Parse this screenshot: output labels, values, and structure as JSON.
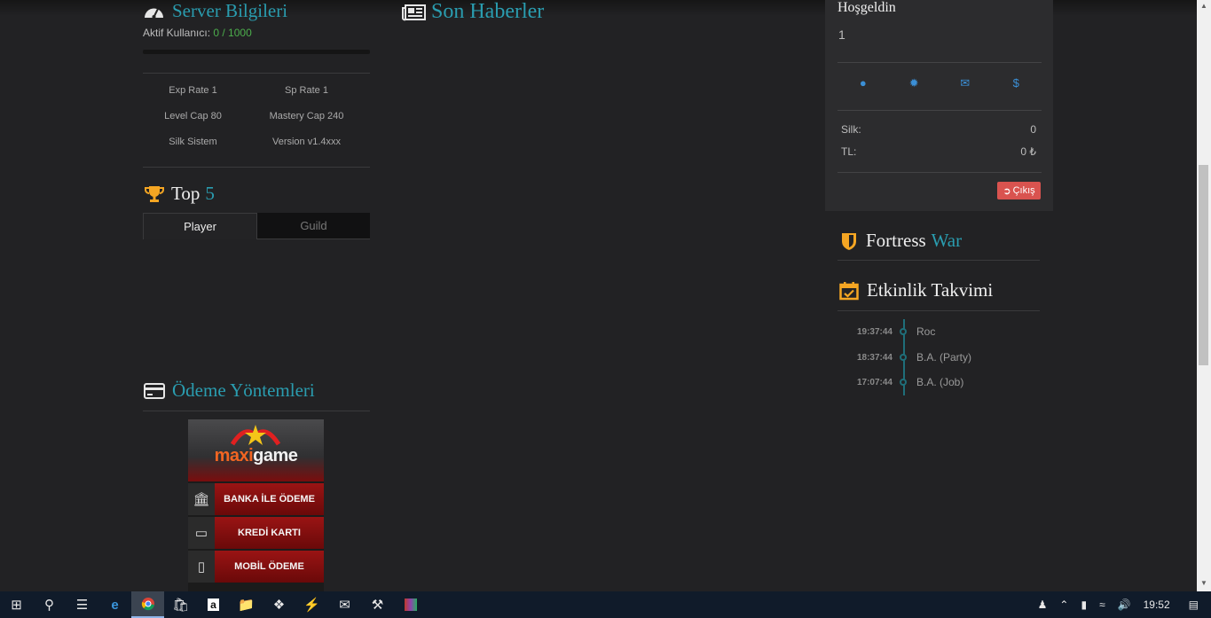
{
  "server": {
    "title": "Server Bilgileri",
    "active_label": "Aktif Kullanıcı:",
    "active_value": "0 / 1000",
    "active_ratio": 0,
    "stats": [
      [
        "Exp Rate 1",
        "Sp Rate 1"
      ],
      [
        "Level Cap 80",
        "Mastery Cap 240"
      ],
      [
        "Silk Sistem",
        "Version v1.4xxx"
      ]
    ]
  },
  "top": {
    "word": "Top",
    "number": "5",
    "tabs": [
      "Player",
      "Guild"
    ]
  },
  "payment": {
    "title": "Ödeme Yöntemleri",
    "brand_left": "maxi",
    "brand_right": "game",
    "methods": [
      "BANKA İLE ÖDEME",
      "KREDİ KARTI",
      "MOBİL ÖDEME"
    ]
  },
  "news": {
    "title": "Son Haberler"
  },
  "user": {
    "greeting": "Hoşgeldin",
    "value": "1",
    "silk_label": "Silk:",
    "silk_value": "0",
    "tl_label": "TL:",
    "tl_value": "0 ₺",
    "logout": "Çıkış"
  },
  "fortress": {
    "word1": "Fortress",
    "word2": "War"
  },
  "events": {
    "title": "Etkinlik Takvimi",
    "items": [
      {
        "time": "19:37:44",
        "name": "Roc"
      },
      {
        "time": "18:37:44",
        "name": "B.A. (Party)"
      },
      {
        "time": "17:07:44",
        "name": "B.A. (Job)"
      }
    ]
  },
  "taskbar": {
    "clock": "19:52"
  },
  "colors": {
    "accent": "#2a9db0",
    "online": "#4cae4c",
    "logout": "#d9534f",
    "icon": "#3b8fd6"
  }
}
